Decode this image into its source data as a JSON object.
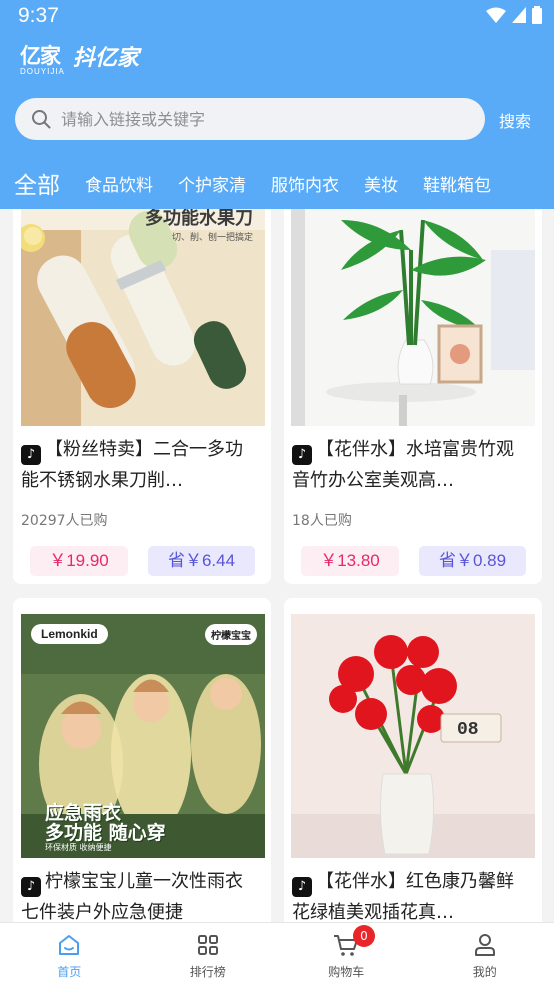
{
  "status_bar": {
    "time": "9:37"
  },
  "app": {
    "logo_mark": "亿家",
    "logo_sub": "DOUYIJIA",
    "name": "抖亿家"
  },
  "search": {
    "placeholder": "请输入链接或关键字",
    "button": "搜索"
  },
  "tabs": [
    "全部",
    "食品饮料",
    "个护家清",
    "服饰内衣",
    "美妆",
    "鞋靴箱包"
  ],
  "products": [
    {
      "title": "【粉丝特卖】二合一多功能不锈钢水果刀削…",
      "image_label": "多功能水果刀",
      "image_sub": "切、削、刨一把搞定",
      "sold": "20297人已购",
      "price": "￥19.90",
      "save": "省￥6.44"
    },
    {
      "title": "【花伴水】水培富贵竹观音竹办公室美观高…",
      "sold": "18人已购",
      "price": "￥13.80",
      "save": "省￥0.89"
    },
    {
      "title": "柠檬宝宝儿童一次性雨衣七件装户外应急便捷",
      "image_brand": "Lemonkid",
      "image_brand2": "柠檬宝宝",
      "image_slogan1": "应急雨衣",
      "image_slogan2": "多功能 随心穿",
      "image_slogan3": "环保材质 收纳便捷"
    },
    {
      "title": "【花伴水】红色康乃馨鲜花绿植美观插花真…",
      "image_clock": "08"
    }
  ],
  "bottom_nav": [
    {
      "label": "首页",
      "icon": "home-icon"
    },
    {
      "label": "排行榜",
      "icon": "grid-icon"
    },
    {
      "label": "购物车",
      "icon": "cart-icon",
      "badge": "0"
    },
    {
      "label": "我的",
      "icon": "user-icon"
    }
  ],
  "colors": {
    "header": "#5aabf7",
    "price_red": "#e8286a",
    "save_blue": "#5a55d6",
    "nav_active": "#4a9ef1"
  }
}
